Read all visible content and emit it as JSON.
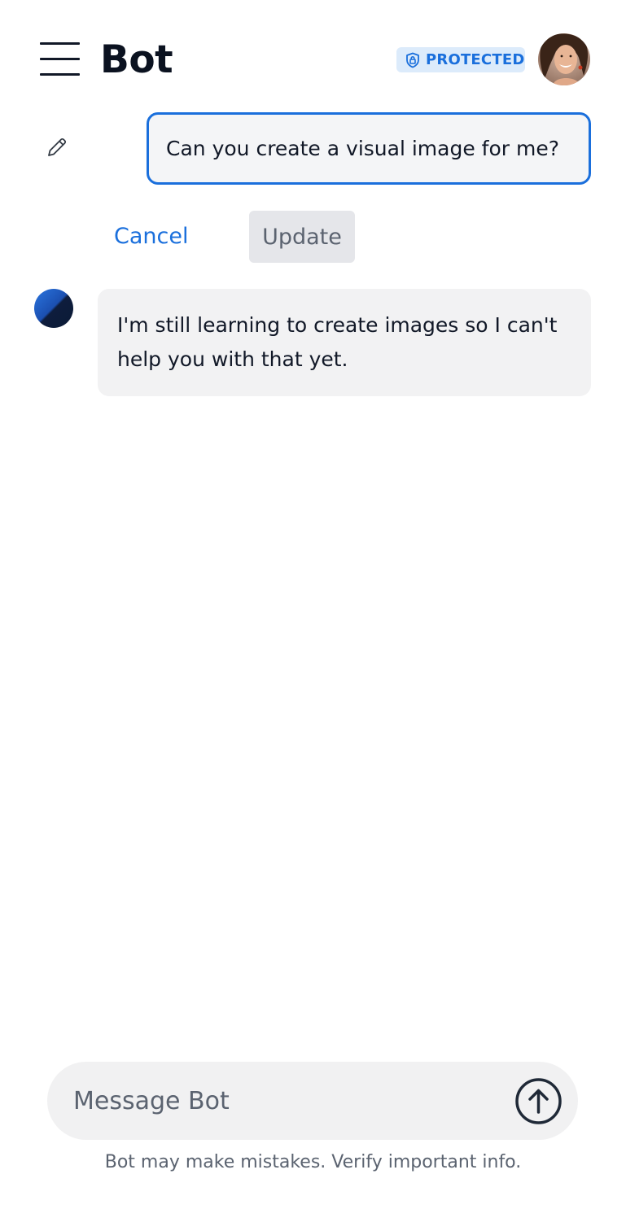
{
  "header": {
    "title": "Bot",
    "badge_label": "PROTECTED",
    "menu_icon": "hamburger-menu-icon",
    "badge_icon": "shield-lock-icon"
  },
  "edit": {
    "icon": "pencil-icon",
    "message_value": "Can you create a visual image for me?",
    "cancel_label": "Cancel",
    "update_label": "Update"
  },
  "conversation": {
    "bot_reply": "I'm still learning to create images so I can't help you with that yet."
  },
  "composer": {
    "placeholder": "Message Bot",
    "send_icon": "arrow-up-circle-icon",
    "disclaimer": "Bot may make mistakes. Verify important info."
  },
  "colors": {
    "accent": "#1a6fdc",
    "badge_bg": "#dcebfb",
    "bubble_bg": "#f2f2f3",
    "text": "#111827",
    "muted": "#5b6370"
  }
}
